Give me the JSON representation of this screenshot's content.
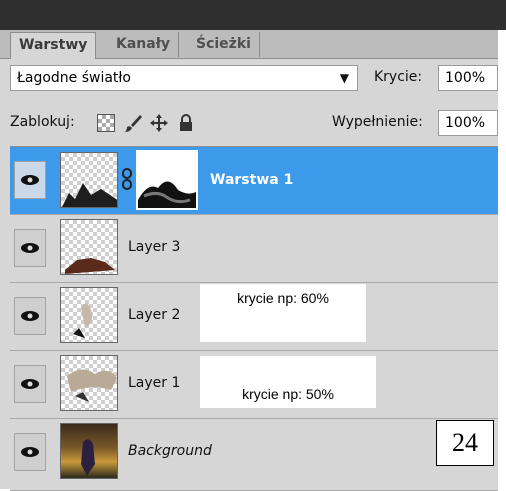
{
  "tabs": [
    {
      "label": "Warstwy",
      "active": true
    },
    {
      "label": "Kanały",
      "active": false
    },
    {
      "label": "Ścieżki",
      "active": false
    }
  ],
  "blend_mode": {
    "value": "Łagodne światło"
  },
  "opacity": {
    "label": "Krycie:",
    "value": "100%"
  },
  "lock": {
    "label": "Zablokuj:"
  },
  "fill": {
    "label": "Wypełnienie:",
    "value": "100%"
  },
  "layers": [
    {
      "name": "Warstwa 1",
      "selected": true
    },
    {
      "name": "Layer 3",
      "selected": false
    },
    {
      "name": "Layer 2",
      "selected": false
    },
    {
      "name": "Layer 1",
      "selected": false
    },
    {
      "name": "Background",
      "selected": false
    }
  ],
  "notes": {
    "layer2": "krycie np: 60%",
    "layer1": "krycie np: 50%"
  },
  "page_number": "24",
  "colors": {
    "selection": "#3d99ea",
    "panel": "#d6d6d6",
    "topbar": "#2f2f2f"
  },
  "icons": [
    "eye-icon",
    "link-icon",
    "lock-transparent-icon",
    "brush-icon",
    "move-icon",
    "lock-icon",
    "dropdown-caret-icon"
  ]
}
